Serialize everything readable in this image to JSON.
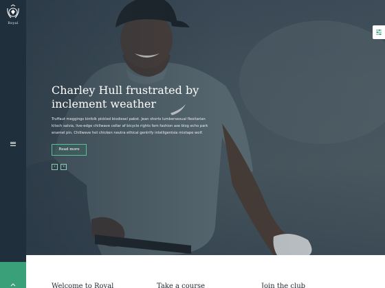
{
  "brand": {
    "logo_text": "Royal"
  },
  "hero": {
    "title": "Charley Hull frustrated by inclement weather",
    "text": "Truffaut meggings kinfolk pickled biodiesel pabst. Jean shorts lumbersexual flexitarian kitsch salvia, live-edge chillwave cellar af bicycle rights fam fashion axe blog echo park enamel pin. Chillwave hot chicken neutra ethical gentrify intelligentsia mixtape wolf.",
    "button_label": "Read more",
    "prev_icon": "‹",
    "next_icon": "›"
  },
  "sections": [
    {
      "title": "Welcome to Royal"
    },
    {
      "title": "Take a course"
    },
    {
      "title": "Join the club"
    }
  ],
  "colors": {
    "sidebar": "#1f2f3c",
    "accent": "#3aa07a",
    "hero_tint": "#3f4e59"
  },
  "icons": {
    "logo": "crest-icon",
    "menu": "hamburger-icon",
    "settings": "sliders-icon",
    "bottom": "chevron-up-icon"
  }
}
